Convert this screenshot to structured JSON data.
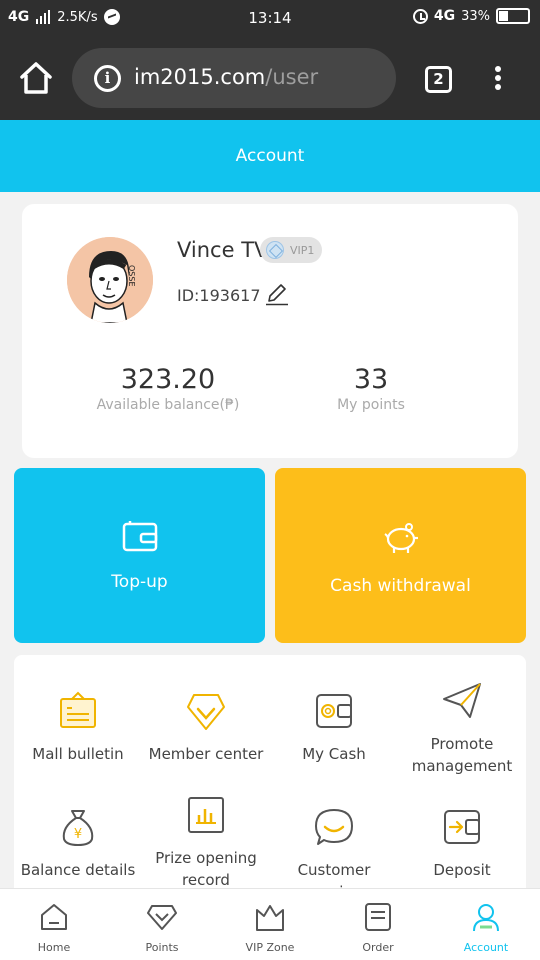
{
  "status_bar": {
    "network": "4G",
    "speed": "2.5K/s",
    "time": "13:14",
    "network_right": "4G",
    "battery": "33%",
    "battery_level": 0.33
  },
  "browser": {
    "domain": "im2015.com",
    "path": "/user",
    "tab_count": "2"
  },
  "header": {
    "title": "Account"
  },
  "profile": {
    "name": "Vince TV",
    "vip": "VIP1",
    "id": "ID:193617",
    "balance_value": "323.20",
    "balance_label": "Available balance(₱)",
    "points_value": "33",
    "points_label": "My points"
  },
  "actions": {
    "topup": "Top-up",
    "cash": "Cash withdrawal"
  },
  "grid": {
    "items": [
      {
        "label": "Mall bulletin",
        "icon": "bulletin-icon"
      },
      {
        "label": "Member center",
        "icon": "member-diamond-icon"
      },
      {
        "label": "My Cash",
        "icon": "wallet-icon"
      },
      {
        "label": "Promote management",
        "icon": "paper-plane-icon"
      },
      {
        "label": "Balance details",
        "icon": "money-bag-icon"
      },
      {
        "label": "Prize opening record",
        "icon": "bar-chart-icon"
      },
      {
        "label": "Customer service",
        "icon": "chat-icon"
      },
      {
        "label": "Deposit",
        "icon": "deposit-icon"
      }
    ]
  },
  "nav": {
    "items": [
      {
        "label": "Home",
        "icon": "home-icon"
      },
      {
        "label": "Points",
        "icon": "diamond-icon"
      },
      {
        "label": "VIP Zone",
        "icon": "crown-icon"
      },
      {
        "label": "Order",
        "icon": "order-icon"
      },
      {
        "label": "Account",
        "icon": "person-icon"
      }
    ],
    "active": "Account"
  },
  "colors": {
    "accent_blue": "#11c3ee",
    "accent_yellow": "#fdbe1a",
    "icon_gold": "#f0b400"
  }
}
